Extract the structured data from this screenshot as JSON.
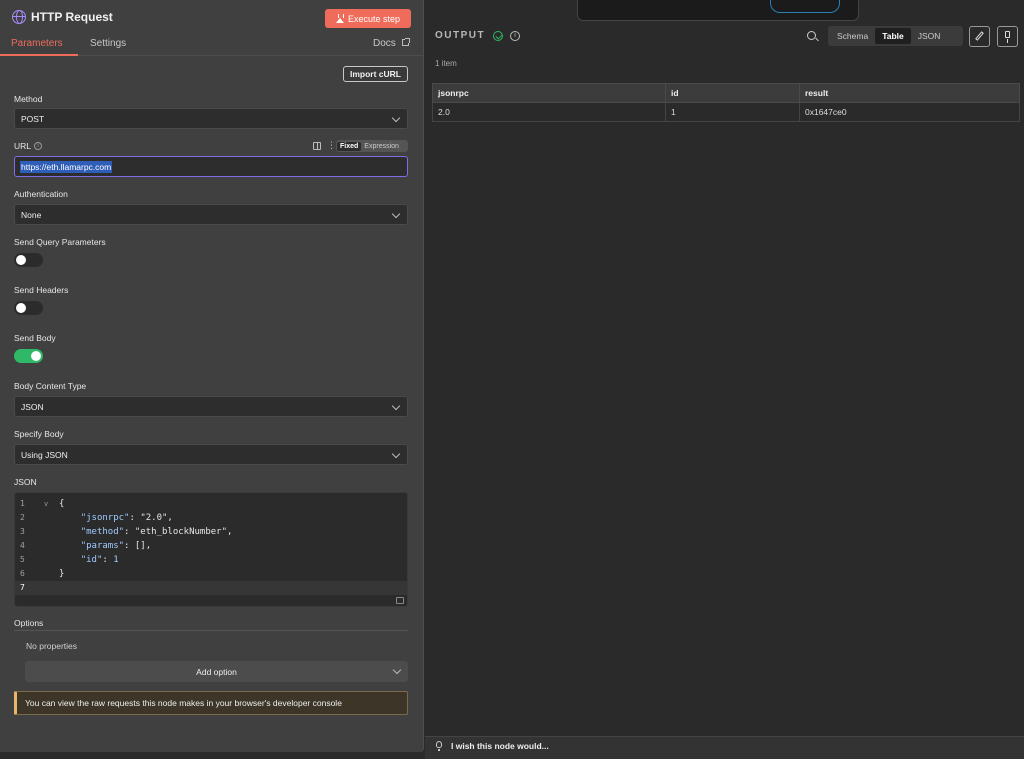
{
  "node": {
    "title": "HTTP Request",
    "execute_label": "Execute step"
  },
  "tabs": [
    {
      "label": "Parameters",
      "active": true
    },
    {
      "label": "Settings",
      "active": false
    }
  ],
  "docs_label": "Docs",
  "import_curl_label": "Import cURL",
  "fields": {
    "method": {
      "label": "Method",
      "value": "POST"
    },
    "url": {
      "label": "URL",
      "value": "https://eth.llamarpc.com",
      "mode_fixed": "Fixed",
      "mode_expression": "Expression"
    },
    "authentication": {
      "label": "Authentication",
      "value": "None"
    },
    "send_query": {
      "label": "Send Query Parameters",
      "enabled": false
    },
    "send_headers": {
      "label": "Send Headers",
      "enabled": false
    },
    "send_body": {
      "label": "Send Body",
      "enabled": true
    },
    "body_content_type": {
      "label": "Body Content Type",
      "value": "JSON"
    },
    "specify_body": {
      "label": "Specify Body",
      "value": "Using JSON"
    },
    "json": {
      "label": "JSON"
    }
  },
  "json_editor": {
    "line_numbers": [
      "1",
      "2",
      "3",
      "4",
      "5",
      "6",
      "7"
    ],
    "line1": "{",
    "line2_key": "\"jsonrpc\"",
    "line2_val": "\"2.0\"",
    "line3_key": "\"method\"",
    "line3_val": "\"eth_blockNumber\"",
    "line4_key": "\"params\"",
    "line4_val": "[]",
    "line5_key": "\"id\"",
    "line5_val": "1",
    "line6": "}",
    "fold_marker": "v"
  },
  "options": {
    "label": "Options",
    "empty_text": "No properties",
    "add_label": "Add option"
  },
  "notice": "You can view the raw requests this node makes in your browser's developer console",
  "output": {
    "title": "OUTPUT",
    "views": [
      "Schema",
      "Table",
      "JSON"
    ],
    "active_view": "Table",
    "item_count": "1 item",
    "columns": [
      "jsonrpc",
      "id",
      "result"
    ],
    "rows": [
      [
        "2.0",
        "1",
        "0x1647ce0"
      ]
    ]
  },
  "footer": {
    "text": "I wish this node would..."
  },
  "colors": {
    "accent": "#ef6b5a",
    "success": "#2fb866",
    "url_border": "#7b6ee8"
  }
}
